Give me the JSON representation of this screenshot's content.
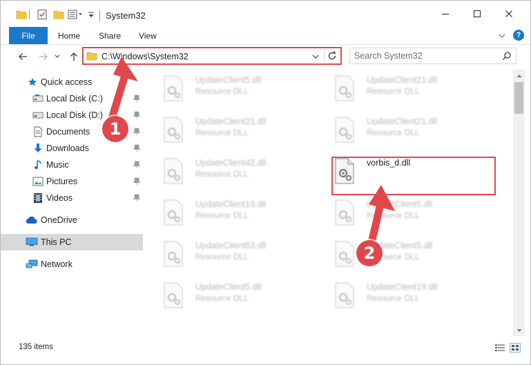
{
  "window": {
    "title": "System32"
  },
  "ribbon": {
    "tabs": [
      "File",
      "Home",
      "Share",
      "View"
    ]
  },
  "address": {
    "path": "C:\\Windows\\System32"
  },
  "search": {
    "placeholder": "Search System32"
  },
  "sidebar": {
    "items": [
      {
        "label": "Quick access",
        "icon": "star-icon",
        "pinned": false
      },
      {
        "label": "Local Disk (C:)",
        "icon": "drive-icon",
        "pinned": true
      },
      {
        "label": "Local Disk (D:)",
        "icon": "drive-icon",
        "pinned": true
      },
      {
        "label": "Documents",
        "icon": "documents-icon",
        "pinned": true
      },
      {
        "label": "Downloads",
        "icon": "download-arrow-icon",
        "pinned": true
      },
      {
        "label": "Music",
        "icon": "music-note-icon",
        "pinned": true
      },
      {
        "label": "Pictures",
        "icon": "pictures-icon",
        "pinned": true
      },
      {
        "label": "Videos",
        "icon": "film-icon",
        "pinned": true
      },
      {
        "label": "OneDrive",
        "icon": "cloud-icon",
        "pinned": false
      },
      {
        "label": "This PC",
        "icon": "monitor-icon",
        "pinned": false,
        "selected": true
      },
      {
        "label": "Network",
        "icon": "network-icon",
        "pinned": false
      }
    ]
  },
  "files": {
    "left": [
      {
        "name": "UpdateClient5.dll",
        "type": "Resource DLL"
      },
      {
        "name": "UpdateClient21.dll",
        "type": "Resource DLL"
      },
      {
        "name": "UpdateClient42.dll",
        "type": "Resource DLL"
      },
      {
        "name": "UpdateClient19.dll",
        "type": "Resource DLL"
      },
      {
        "name": "UpdateClient63.dll",
        "type": "Resource DLL"
      },
      {
        "name": "UpdateClient5.dll",
        "type": "Resource DLL"
      }
    ],
    "right": [
      {
        "name": "UpdateClient21.dll",
        "type": "Resource DLL"
      },
      {
        "name": "UpdateClient21.dll",
        "type": "Resource DLL"
      },
      {
        "name": "vorbis_d.dll",
        "type": "",
        "highlighted": true
      },
      {
        "name": "UpdateClient5.dll",
        "type": "Resource DLL"
      },
      {
        "name": "UpdateClient5.dll",
        "type": "Resource DLL"
      },
      {
        "name": "UpdateClient19.dll",
        "type": "Resource DLL"
      }
    ]
  },
  "status": {
    "item_count": "135 items"
  },
  "annotations": {
    "step1": "1",
    "step2": "2",
    "color": "#e0474c"
  },
  "colors": {
    "accent": "#1979ca",
    "highlight": "#e0474c",
    "selected_bg": "#d9d9d9"
  }
}
